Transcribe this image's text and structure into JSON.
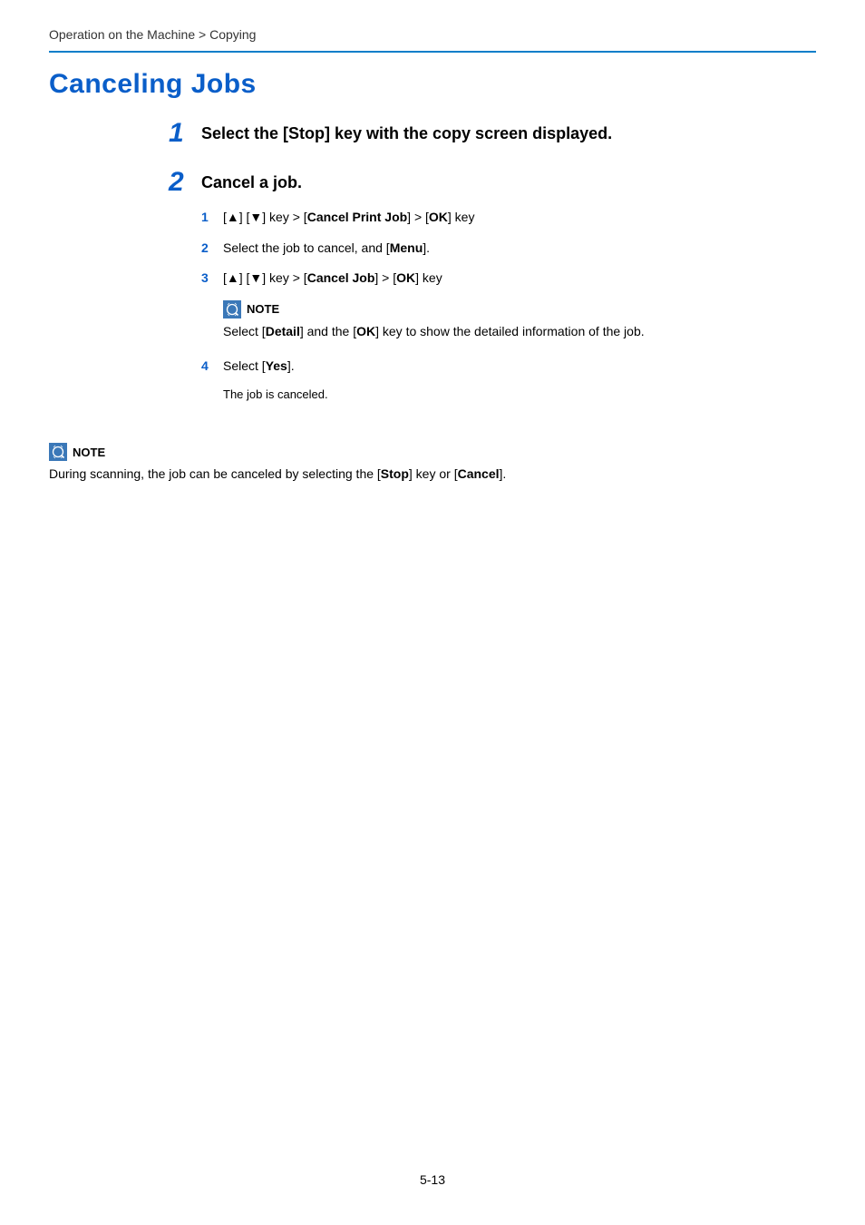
{
  "breadcrumb": {
    "section": "Operation on the Machine",
    "subsection": "Copying",
    "sep": " > "
  },
  "heading": "Canceling Jobs",
  "steps": {
    "s1": {
      "num": "1",
      "title": "Select the [Stop] key with the copy screen displayed."
    },
    "s2": {
      "num": "2",
      "title": "Cancel a job.",
      "subs": {
        "a": {
          "num": "1",
          "lead": "[",
          "up": "▲",
          "mid1": "] [",
          "down": "▼",
          "mid2": "] key > [",
          "bold1": "Cancel Print Job",
          "mid3": "] > [",
          "bold2": "OK",
          "tail": "] key"
        },
        "b": {
          "num": "2",
          "lead": "Select the job to cancel, and [",
          "bold1": "Menu",
          "tail": "]."
        },
        "c": {
          "num": "3",
          "lead": "[",
          "up": "▲",
          "mid1": "] [",
          "down": "▼",
          "mid2": "] key > [",
          "bold1": "Cancel Job",
          "mid3": "] > [",
          "bold2": "OK",
          "tail": "] key"
        },
        "note_inner": {
          "label": "NOTE",
          "lead": "Select [",
          "bold1": "Detail",
          "mid1": "] and the [",
          "bold2": "OK",
          "tail": "] key to show the detailed information of the job."
        },
        "d": {
          "num": "4",
          "lead": "Select [",
          "bold1": "Yes",
          "tail": "].",
          "result": "The job is canceled."
        }
      }
    }
  },
  "note_outer": {
    "label": "NOTE",
    "lead": "During scanning, the job can be canceled by selecting the [",
    "bold1": "Stop",
    "mid1": "] key or [",
    "bold2": "Cancel",
    "tail": "]."
  },
  "page_num": "5-13"
}
